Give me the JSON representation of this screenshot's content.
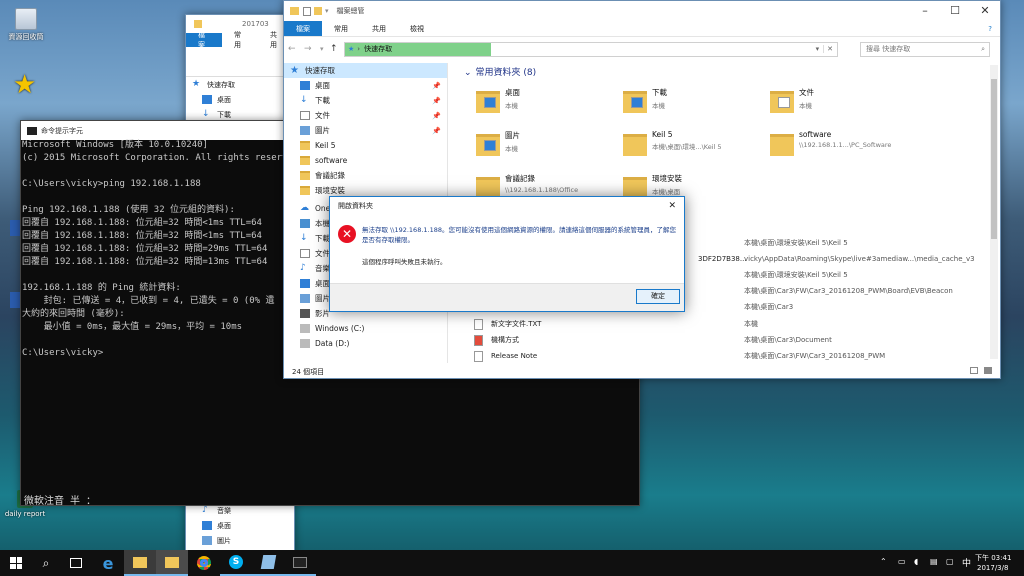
{
  "desktop": {
    "icons": [
      {
        "label": "資源回收筒",
        "name": "recycle-bin"
      },
      {
        "label": "",
        "name": "star-shortcut"
      },
      {
        "label": "daily report",
        "name": "daily-report"
      }
    ]
  },
  "cmd": {
    "title": "命令提示字元",
    "lines": [
      "Microsoft Windows [版本 10.0.10240]",
      "(c) 2015 Microsoft Corporation. All rights reserved",
      "",
      "C:\\Users\\vicky>ping 192.168.1.188",
      "",
      "Ping 192.168.1.188 (使用 32 位元組的資料):",
      "回覆自 192.168.1.188: 位元組=32 時間<1ms TTL=64",
      "回覆自 192.168.1.188: 位元組=32 時間<1ms TTL=64",
      "回覆自 192.168.1.188: 位元組=32 時間=29ms TTL=64",
      "回覆自 192.168.1.188: 位元組=32 時間=13ms TTL=64",
      "",
      "192.168.1.188 的 Ping 統計資料:",
      "    封包: 已傳送 = 4，已收到 = 4, 已遺失 = 0 (0% 遺",
      "大約的來回時間 (毫秒):",
      "    最小值 = 0ms，最大值 = 29ms，平均 = 10ms",
      "",
      "C:\\Users\\vicky>"
    ],
    "bottom_text": "微軟注音 半 ："
  },
  "back_explorer": {
    "title": "201703",
    "tabs": [
      "檔案",
      "常用",
      "共用"
    ],
    "nav": [
      "快速存取",
      "桌面",
      "下載"
    ],
    "bottom_nav": [
      "音樂",
      "桌面",
      "圖片"
    ]
  },
  "explorer": {
    "title": "檔案總管",
    "tabs": [
      "檔案",
      "常用",
      "共用",
      "檢視"
    ],
    "address": "快速存取",
    "search_placeholder": "搜尋 快速存取",
    "nav_quick": "快速存取",
    "nav": [
      {
        "label": "桌面",
        "icon": "desktop",
        "pin": true
      },
      {
        "label": "下載",
        "icon": "download",
        "pin": true
      },
      {
        "label": "文件",
        "icon": "document",
        "pin": true
      },
      {
        "label": "圖片",
        "icon": "picture",
        "pin": true
      },
      {
        "label": "Keil 5",
        "icon": "folder"
      },
      {
        "label": "software",
        "icon": "folder"
      },
      {
        "label": "會議記錄",
        "icon": "folder"
      },
      {
        "label": "環境安裝",
        "icon": "folder"
      }
    ],
    "nav2": [
      {
        "label": "OneDrive",
        "icon": "onedrive"
      },
      {
        "label": "本機",
        "icon": "pc"
      },
      {
        "label": "下載",
        "icon": "download"
      },
      {
        "label": "文件",
        "icon": "document"
      },
      {
        "label": "音樂",
        "icon": "music"
      },
      {
        "label": "桌面",
        "icon": "desktop"
      },
      {
        "label": "圖片",
        "icon": "picture"
      },
      {
        "label": "影片",
        "icon": "video"
      },
      {
        "label": "Windows (C:)",
        "icon": "drive"
      },
      {
        "label": "Data (D:)",
        "icon": "drive"
      }
    ],
    "frequent_header": "常用資料夾 (8)",
    "folders": [
      {
        "name": "桌面",
        "sub": "本機",
        "icon": "desktop"
      },
      {
        "name": "下載",
        "sub": "本機",
        "icon": "download"
      },
      {
        "name": "文件",
        "sub": "本機",
        "icon": "document"
      },
      {
        "name": "圖片",
        "sub": "本機",
        "icon": "picture"
      },
      {
        "name": "Keil 5",
        "sub": "本機\\桌面\\環境...\\Keil 5",
        "icon": "folder"
      },
      {
        "name": "software",
        "sub": "\\\\192.168.1.1...\\PC_Software",
        "icon": "folder"
      },
      {
        "name": "會議記錄",
        "sub": "\\\\192.168.1.188\\Office",
        "icon": "folder"
      },
      {
        "name": "環境安裝",
        "sub": "本機\\桌面",
        "icon": "folder"
      }
    ],
    "recent": [
      {
        "name": "",
        "path": "本機\\桌面\\環境安裝\\Keil 5\\Keil 5"
      },
      {
        "name": "3DF2D7B38...",
        "path": "vicky\\AppData\\Roaming\\Skype\\live#3amediaw...\\media_cache_v3"
      },
      {
        "name": "",
        "path": "本機\\桌面\\環境安裝\\Keil 5\\Keil 5"
      },
      {
        "name": "",
        "path": "本機\\桌面\\Car3\\FW\\Car3_20161208_PWM\\Board\\EVB\\Beacon"
      },
      {
        "name": "",
        "path": "本機\\桌面\\Car3"
      },
      {
        "name": "新文字文件.TXT",
        "path": "本機"
      },
      {
        "name": "機構方式",
        "path": "本機\\桌面\\Car3\\Document"
      },
      {
        "name": "Release Note",
        "path": "本機\\桌面\\Car3\\FW\\Car3_20161208_PWM"
      }
    ],
    "status": "24 個項目"
  },
  "dialog": {
    "title": "開啟資料夾",
    "message": "無法存取 \\\\192.168.1.188。您可能沒有使用這個網路資源的權限。請連絡這個伺服器的系統管理員，了解您是否有存取權限。",
    "detail": "這個程序呼叫失敗且未執行。",
    "ok": "確定"
  },
  "taskbar": {
    "time": "下午 03:41",
    "date": "2017/3/8"
  },
  "colors": {
    "accent": "#1979ca",
    "error": "#e81123"
  }
}
